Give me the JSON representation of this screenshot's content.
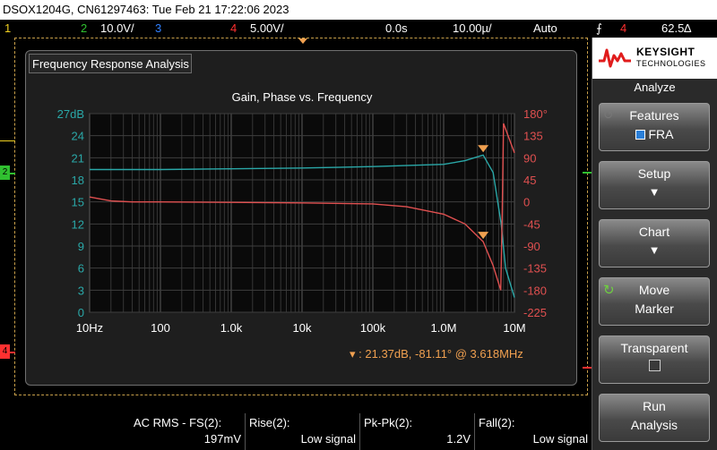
{
  "header": {
    "title": "DSOX1204G, CN61297463: Tue Feb 21 17:22:06 2023"
  },
  "channels": {
    "ch1_num": "1",
    "ch2_num": "2",
    "ch2_scale": "10.0V/",
    "ch3_num": "3",
    "ch4_num": "4",
    "ch4_scale": "5.00V/",
    "delay": "0.0s",
    "timebase": "10.00µ/",
    "trigger_mode": "Auto",
    "trigger_channel": "4",
    "trigger_level": "62.5∆"
  },
  "colors": {
    "ch1": "#f0d020",
    "ch2": "#30c030",
    "ch3": "#3080ff",
    "ch4": "#ff3030",
    "gain": "#2aa8a8",
    "phase": "#e05050",
    "marker": "#f0a050"
  },
  "fra": {
    "panel_title": "Frequency Response Analysis",
    "marker_readout": "21.37dB, -81.11° @ 3.618MHz"
  },
  "chart_data": {
    "type": "line",
    "title": "Gain, Phase vs. Frequency",
    "xscale": "log",
    "xlim": [
      10,
      10000000
    ],
    "x_tick_labels": [
      "10Hz",
      "100",
      "1.0k",
      "10k",
      "100k",
      "1.0M",
      "10M"
    ],
    "y_left_tick_labels": [
      "27dB",
      "24",
      "21",
      "18",
      "15",
      "12",
      "9",
      "6",
      "3",
      "0"
    ],
    "y_right_tick_labels": [
      "180°",
      "135",
      "90",
      "45",
      "0",
      "-45",
      "-90",
      "-135",
      "-180",
      "-225"
    ],
    "ylim_left": [
      0,
      27
    ],
    "ylim_right": [
      -225,
      180
    ],
    "grid": true,
    "series": [
      {
        "axis": "left",
        "points": [
          [
            10,
            19.4
          ],
          [
            100,
            19.4
          ],
          [
            1000,
            19.5
          ],
          [
            10000,
            19.6
          ],
          [
            100000,
            19.8
          ],
          [
            1000000,
            20.1
          ],
          [
            2000000,
            20.6
          ],
          [
            3618000,
            21.37
          ],
          [
            5000000,
            19
          ],
          [
            6500000,
            12
          ],
          [
            7500000,
            6
          ],
          [
            10000000,
            2
          ]
        ]
      },
      {
        "axis": "right",
        "points": [
          [
            10,
            10
          ],
          [
            20,
            2
          ],
          [
            40,
            0
          ],
          [
            100,
            0
          ],
          [
            1000,
            -1
          ],
          [
            10000,
            -2
          ],
          [
            100000,
            -4
          ],
          [
            300000,
            -10
          ],
          [
            1000000,
            -25
          ],
          [
            2000000,
            -45
          ],
          [
            3618000,
            -81.11
          ],
          [
            5000000,
            -130
          ],
          [
            6400000,
            -180
          ],
          [
            6700000,
            -30
          ],
          [
            7000000,
            160
          ],
          [
            10000000,
            100
          ]
        ]
      }
    ],
    "markers": [
      {
        "series": 0,
        "x": 3618000,
        "y": 21.37
      },
      {
        "series": 1,
        "x": 3618000,
        "y": -81.11
      }
    ]
  },
  "measurements": [
    {
      "label": "AC RMS - FS(2):",
      "value": "197mV"
    },
    {
      "label": "Rise(2):",
      "value": "Low signal"
    },
    {
      "label": "Pk-Pk(2):",
      "value": "1.2V"
    },
    {
      "label": "Fall(2):",
      "value": "Low signal"
    }
  ],
  "sidebar": {
    "brand": "KEYSIGHT",
    "brand_sub": "TECHNOLOGIES",
    "menu_title": "Analyze",
    "keys": [
      {
        "line1": "Features",
        "line2": "FRA"
      },
      {
        "line1": "Setup",
        "line2": ""
      },
      {
        "line1": "Chart",
        "line2": ""
      },
      {
        "line1": "Move",
        "line2": "Marker"
      },
      {
        "line1": "Transparent",
        "line2": ""
      },
      {
        "line1": "Run",
        "line2": "Analysis"
      }
    ]
  }
}
